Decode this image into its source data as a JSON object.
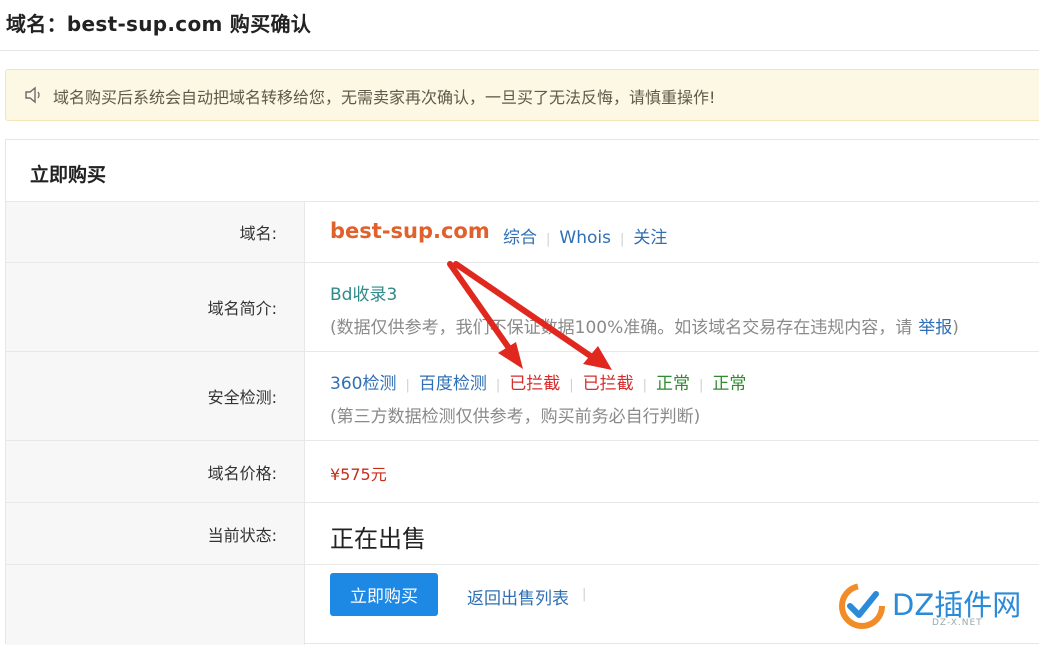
{
  "page": {
    "title": "域名：best-sup.com 购买确认"
  },
  "notice": {
    "text": "域名购买后系统会自动把域名转移给您，无需卖家再次确认，一旦买了无法反悔，请慎重操作!"
  },
  "panel": {
    "title": "立即购买"
  },
  "rows": {
    "domain": {
      "label": "域名:",
      "value": "best-sup.com",
      "links": [
        "综合",
        "Whois",
        "关注"
      ]
    },
    "intro": {
      "label": "域名简介:",
      "value": "Bd收录3",
      "note_prefix": "(数据仅供参考，我们不保证数据100%准确。如该域名交易存在违规内容，请",
      "report_link": "举报",
      "note_suffix": ")"
    },
    "security": {
      "label": "安全检测:",
      "items": [
        "360检测",
        "百度检测",
        "已拦截",
        "已拦截",
        "正常",
        "正常"
      ],
      "note": "(第三方数据检测仅供参考，购买前务必自行判断)"
    },
    "price": {
      "label": "域名价格:",
      "value": "¥575元"
    },
    "status": {
      "label": "当前状态:",
      "value": "正在出售"
    },
    "actions": {
      "buy_button": "立即购买",
      "back_link": "返回出售列表"
    }
  },
  "watermark": {
    "text": "DZ插件网",
    "sub": "DZ-X.NET"
  },
  "colors": {
    "accent": "#1e88e5",
    "domain": "#e0612c",
    "blocked": "#d62c2c",
    "normal": "#2e8b2e",
    "link": "#2f6fb5",
    "arrow": "#e0281f"
  },
  "icons": {
    "notice": "speaker-icon",
    "watermark": "dz-logo-icon"
  }
}
